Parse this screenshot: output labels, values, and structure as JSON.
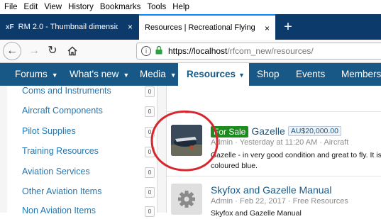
{
  "menubar": {
    "items": [
      "File",
      "Edit",
      "View",
      "History",
      "Bookmarks",
      "Tools",
      "Help"
    ]
  },
  "tabs": [
    {
      "icon": "xenforo-icon",
      "title": "RM 2.0 - Thumbnail dimension",
      "close": "×"
    },
    {
      "title": "Resources | Recreational Flying",
      "close": "×"
    }
  ],
  "toolbar": {
    "url_host": "https://localhost",
    "url_path": "/rfcom_new/resources/"
  },
  "nav": {
    "items": [
      "Forums",
      "What's new",
      "Media",
      "Resources",
      "Shop",
      "Events",
      "Members"
    ]
  },
  "sidebar": {
    "categories": [
      {
        "label": "Coms and Instruments",
        "count": "0"
      },
      {
        "label": "Aircraft Components",
        "count": "0"
      },
      {
        "label": "Pilot Supplies",
        "count": "0"
      },
      {
        "label": "Training Resources",
        "count": "0"
      },
      {
        "label": "Aviation Services",
        "count": "0"
      },
      {
        "label": "Other Aviation Items",
        "count": "0"
      },
      {
        "label": "Non Aviation Items",
        "count": "0"
      }
    ]
  },
  "resources": [
    {
      "prefix": "For Sale",
      "title": "Gazelle",
      "price": "AU$20,000.00",
      "author": "Admin",
      "date": "Yesterday at 11:20 AM",
      "category": "Aircraft",
      "desc_line1": "Gazelle - in very good condition and great to fly. It is",
      "desc_line2": "coloured blue."
    },
    {
      "title": "Skyfox and Gazelle Manual",
      "author": "Admin",
      "date": "Feb 22, 2017",
      "category": "Free Resources",
      "desc_line1": "Skyfox and Gazelle Manual"
    }
  ],
  "meta_sep": "·",
  "annotation_color": "#d6262e"
}
